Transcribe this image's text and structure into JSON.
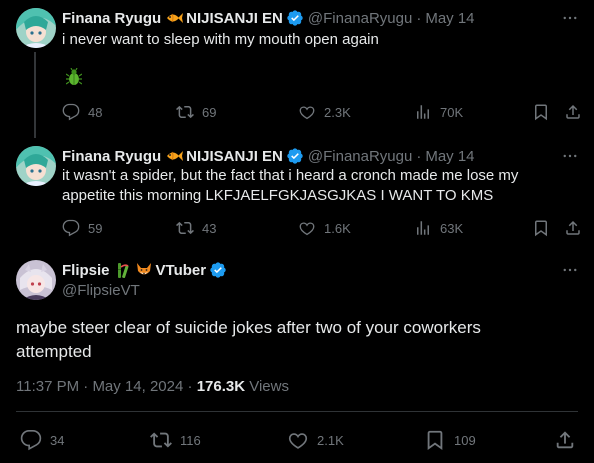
{
  "colors": {
    "bg": "#000000",
    "text": "#e7e9ea",
    "muted": "#71767b",
    "verified": "#1d9bf0",
    "divider": "#2f3336"
  },
  "tweets": [
    {
      "author": "Finana Ryugu",
      "org": "NIJISANJI EN",
      "handle": "@FinanaRyugu",
      "date": "May 14",
      "text": "i never want to sleep with my mouth open again",
      "media_emoji": "bug",
      "replies": "48",
      "retweets": "69",
      "likes": "2.3K",
      "views": "70K"
    },
    {
      "author": "Finana Ryugu",
      "org": "NIJISANJI EN",
      "handle": "@FinanaRyugu",
      "date": "May 14",
      "text_line1": "it wasn't a spider, but the fact that i heard a cronch made me lose my",
      "text_line2": "appetite this morning LKFJAELFGKJASGJKAS I WANT TO KMS",
      "replies": "59",
      "retweets": "43",
      "likes": "1.6K",
      "views": "63K"
    }
  ],
  "main": {
    "author": "Flipsie",
    "suffix": "VTuber",
    "handle": "@FlipsieVT",
    "text_line1": "maybe steer clear of suicide jokes after two of your coworkers",
    "text_line2": "attempted",
    "time": "11:37 PM",
    "date": "May 14, 2024",
    "views_count": "176.3K",
    "views_label": "Views",
    "replies": "34",
    "retweets": "116",
    "likes": "2.1K",
    "bookmarks": "109"
  },
  "separators": {
    "middot": "·"
  }
}
